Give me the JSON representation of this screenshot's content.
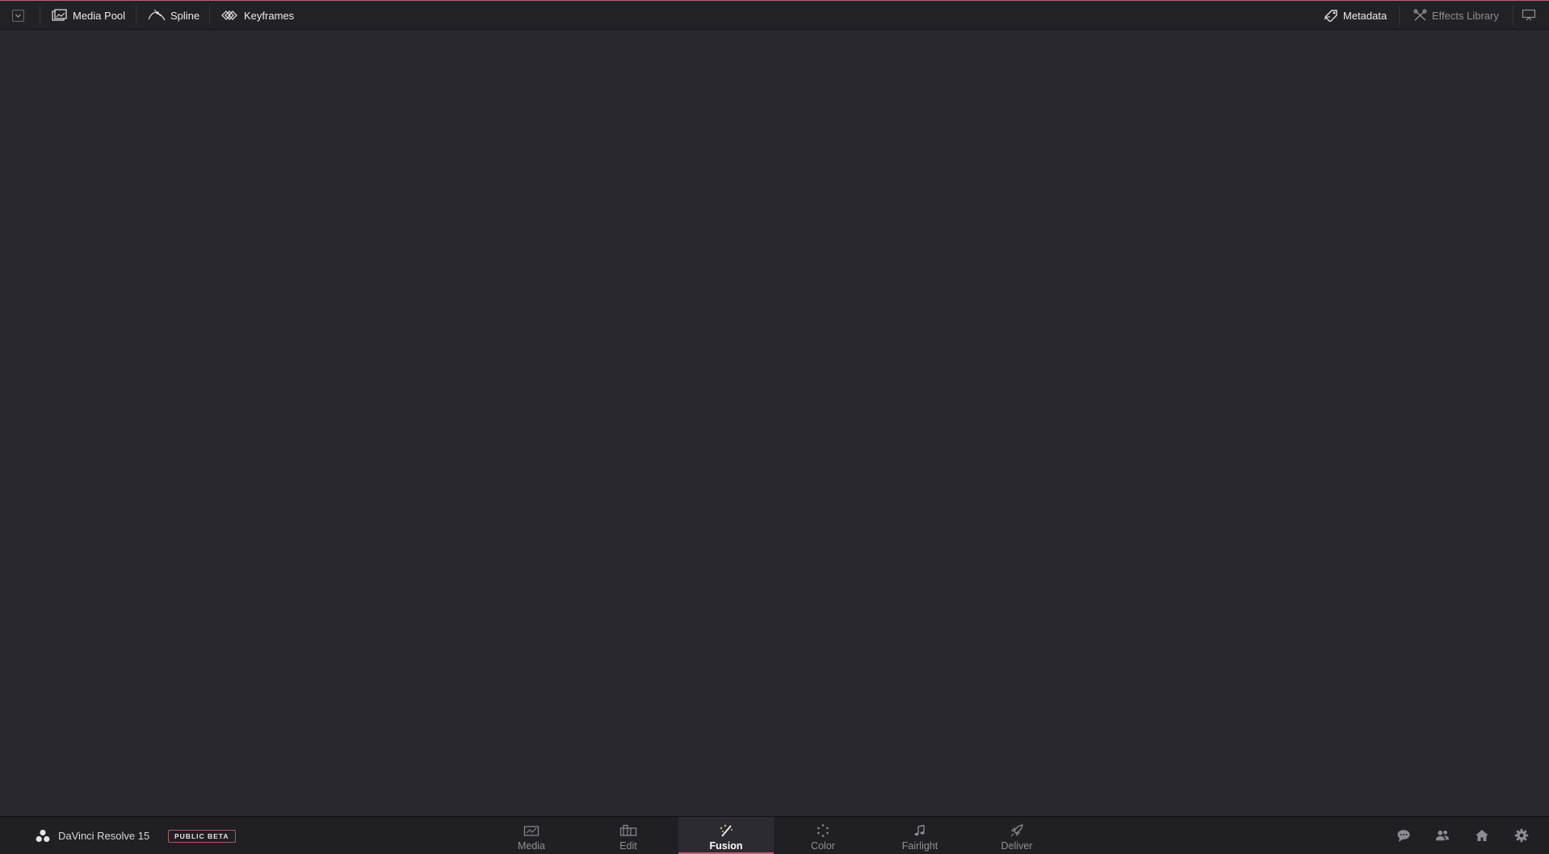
{
  "top_toolbar": {
    "left_items": [
      {
        "label": "Media Pool",
        "icon": "media-pool-icon"
      },
      {
        "label": "Spline",
        "icon": "spline-icon"
      },
      {
        "label": "Keyframes",
        "icon": "keyframes-icon"
      }
    ],
    "right_items": [
      {
        "label": "Metadata",
        "icon": "metadata-icon"
      },
      {
        "label": "Effects Library",
        "icon": "effects-library-icon"
      }
    ],
    "workspace_dropdown_icon": "chevron-down-icon",
    "fullscreen_icon": "fullscreen-icon"
  },
  "bottom_bar": {
    "app_name": "DaVinci Resolve 15",
    "badge": "PUBLIC BETA",
    "pages": [
      {
        "label": "Media",
        "icon": "media-page-icon"
      },
      {
        "label": "Edit",
        "icon": "edit-page-icon"
      },
      {
        "label": "Fusion",
        "icon": "fusion-page-icon",
        "active": true
      },
      {
        "label": "Color",
        "icon": "color-page-icon"
      },
      {
        "label": "Fairlight",
        "icon": "fairlight-page-icon"
      },
      {
        "label": "Deliver",
        "icon": "deliver-page-icon"
      }
    ],
    "right_icons": [
      "chat-icon",
      "collaboration-icon",
      "home-icon",
      "settings-icon"
    ]
  },
  "colors": {
    "accent": "#c45b68",
    "background": "#28282e",
    "toolbar": "#212126"
  }
}
